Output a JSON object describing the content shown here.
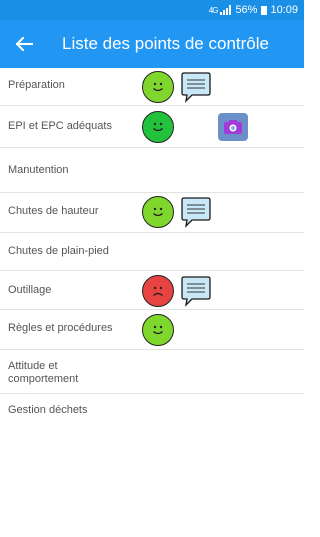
{
  "status": {
    "network": "4G",
    "battery": "56%",
    "time": "10:09"
  },
  "header": {
    "back_icon": "arrow-left-icon",
    "title": "Liste des points de contrôle"
  },
  "colors": {
    "app_bar": "#2196f3",
    "status_bar": "#1a8fe6",
    "face_green_light": "#7fd62c",
    "face_green": "#22c23c",
    "face_red": "#e84343",
    "bubble": "#c9e8f7",
    "camera": "#6b8fc9"
  },
  "checkpoints": [
    {
      "label": "Préparation",
      "status": "good",
      "has_comment": true,
      "has_photo": false
    },
    {
      "label": "EPI et EPC adéquats",
      "status": "good",
      "has_comment": false,
      "has_photo": true
    },
    {
      "label": "Manutention",
      "status": null,
      "has_comment": false,
      "has_photo": false
    },
    {
      "label": "Chutes de hauteur",
      "status": "good",
      "has_comment": true,
      "has_photo": false
    },
    {
      "label": "Chutes de plain-pied",
      "status": null,
      "has_comment": false,
      "has_photo": false
    },
    {
      "label": "Outillage",
      "status": "bad",
      "has_comment": true,
      "has_photo": false
    },
    {
      "label": "Règles et procédures",
      "status": "good",
      "has_comment": false,
      "has_photo": false
    },
    {
      "label": "Attitude et comportement",
      "status": null,
      "has_comment": false,
      "has_photo": false
    },
    {
      "label": "Gestion déchets",
      "status": null,
      "has_comment": false,
      "has_photo": false
    }
  ]
}
